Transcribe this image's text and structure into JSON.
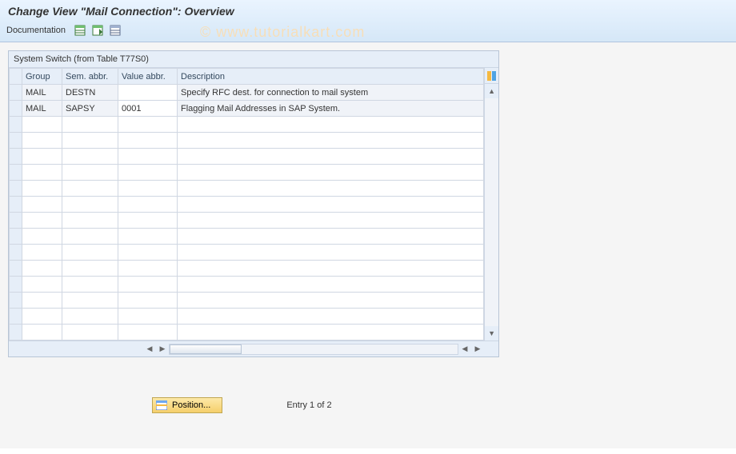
{
  "header": {
    "title": "Change View \"Mail Connection\": Overview"
  },
  "toolbar": {
    "documentation_label": "Documentation"
  },
  "watermark": "© www.tutorialkart.com",
  "panel": {
    "title": "System Switch (from Table T77S0)",
    "columns": {
      "group": "Group",
      "sem_abbr": "Sem. abbr.",
      "value_abbr": "Value abbr.",
      "description": "Description"
    },
    "rows": [
      {
        "group": "MAIL",
        "sem": "DESTN",
        "val": "",
        "desc": "Specify RFC dest. for connection to mail system"
      },
      {
        "group": "MAIL",
        "sem": "SAPSY",
        "val": "0001",
        "desc": "Flagging Mail Addresses in SAP System."
      },
      {
        "group": "",
        "sem": "",
        "val": "",
        "desc": ""
      },
      {
        "group": "",
        "sem": "",
        "val": "",
        "desc": ""
      },
      {
        "group": "",
        "sem": "",
        "val": "",
        "desc": ""
      },
      {
        "group": "",
        "sem": "",
        "val": "",
        "desc": ""
      },
      {
        "group": "",
        "sem": "",
        "val": "",
        "desc": ""
      },
      {
        "group": "",
        "sem": "",
        "val": "",
        "desc": ""
      },
      {
        "group": "",
        "sem": "",
        "val": "",
        "desc": ""
      },
      {
        "group": "",
        "sem": "",
        "val": "",
        "desc": ""
      },
      {
        "group": "",
        "sem": "",
        "val": "",
        "desc": ""
      },
      {
        "group": "",
        "sem": "",
        "val": "",
        "desc": ""
      },
      {
        "group": "",
        "sem": "",
        "val": "",
        "desc": ""
      },
      {
        "group": "",
        "sem": "",
        "val": "",
        "desc": ""
      },
      {
        "group": "",
        "sem": "",
        "val": "",
        "desc": ""
      },
      {
        "group": "",
        "sem": "",
        "val": "",
        "desc": ""
      }
    ]
  },
  "footer": {
    "position_label": "Position...",
    "entry_text": "Entry 1 of 2"
  }
}
